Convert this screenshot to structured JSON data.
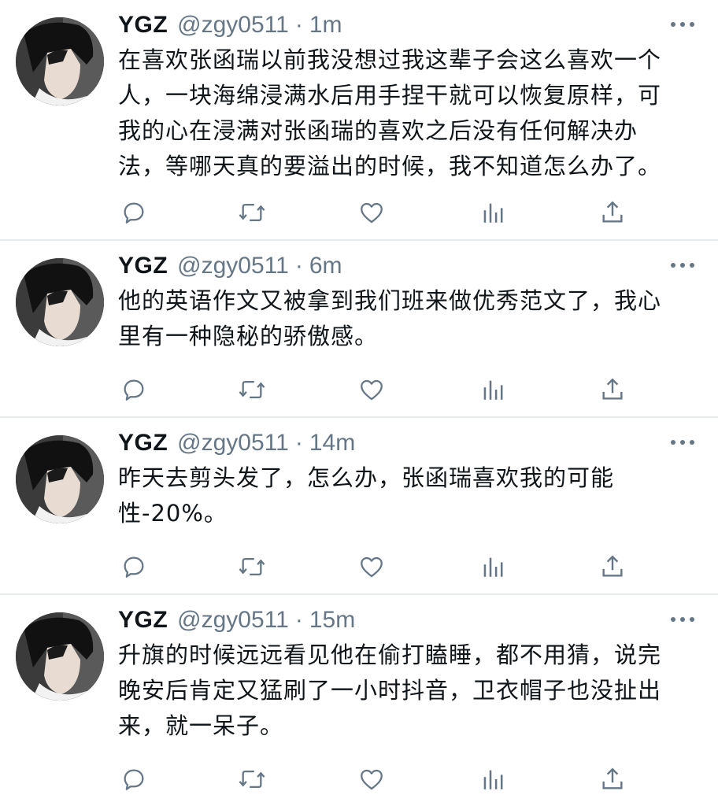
{
  "tweets": [
    {
      "name": "YGZ",
      "handle": "@zgy0511",
      "separator": "·",
      "time": "1m",
      "text": "在喜欢张函瑞以前我没想过我这辈子会这么喜欢一个\n人，一块海绵浸满水后用手捏干就可以恢复原样，可\n我的心在浸满对张函瑞的喜欢之后没有任何解决办\n法，等哪天真的要溢出的时候，我不知道怎么办了。"
    },
    {
      "name": "YGZ",
      "handle": "@zgy0511",
      "separator": "·",
      "time": "6m",
      "text": "他的英语作文又被拿到我们班来做优秀范文了，我心\n里有一种隐秘的骄傲感。"
    },
    {
      "name": "YGZ",
      "handle": "@zgy0511",
      "separator": "·",
      "time": "14m",
      "text": "昨天去剪头发了，怎么办，张函瑞喜欢我的可能\n性-20%。"
    },
    {
      "name": "YGZ",
      "handle": "@zgy0511",
      "separator": "·",
      "time": "15m",
      "text": "升旗的时候远远看见他在偷打瞌睡，都不用猜，说完\n晚安后肯定又猛刷了一小时抖音，卫衣帽子也没扯出\n来，就一呆子。"
    }
  ],
  "icons": {
    "reply": "reply-icon",
    "retweet": "retweet-icon",
    "like": "like-icon",
    "analytics": "analytics-icon",
    "share": "share-icon",
    "more": "more-icon"
  },
  "colors": {
    "text": "#0f1419",
    "secondary": "#657786",
    "divider": "#e6e9eb",
    "background": "#ffffff"
  }
}
